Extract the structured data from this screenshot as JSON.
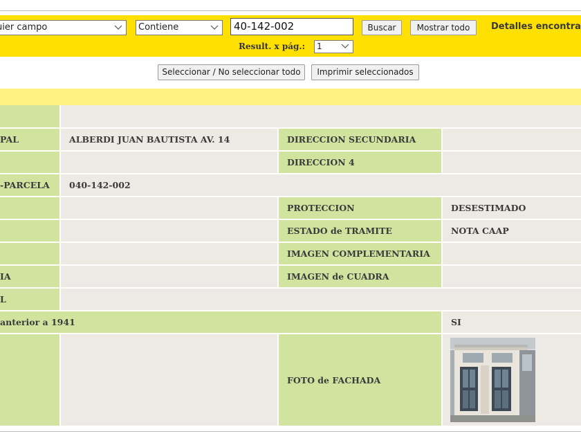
{
  "search": {
    "field_select": "uier campo",
    "condition_select": "Contiene",
    "query_value": "40-142-002",
    "search_button": "Buscar",
    "show_all_button": "Mostrar todo",
    "details_label": "Detalles encontra",
    "per_page_label": "Result. x pág.:",
    "per_page_value": "1"
  },
  "actions": {
    "toggle_select_button": "Seleccionar / No seleccionar todo",
    "print_button": "Imprimir seleccionados"
  },
  "record": {
    "direccion_principal_label": "PAL",
    "direccion_principal_value": "ALBERDI JUAN BAUTISTA AV. 14",
    "direccion_secundaria_label": "DIRECCION SECUNDARIA",
    "direccion_4_label": "DIRECCION 4",
    "parcela_label": "-PARCELA",
    "parcela_value": "040-142-002",
    "proteccion_label": "PROTECCION",
    "proteccion_value": "DESESTIMADO",
    "estado_tramite_label": "ESTADO de TRAMITE",
    "estado_tramite_value": "NOTA CAAP",
    "imagen_complementaria_label": "IMAGEN COMPLEMENTARIA",
    "row8_label": "IA",
    "imagen_cuadra_label": "IMAGEN de CUADRA",
    "row9_label": "L",
    "anterior_1941_label": "anterior a 1941",
    "anterior_1941_value": "SI",
    "foto_fachada_label": "FOTO de FACHADA"
  },
  "colors": {
    "search_bar": "#ffe000",
    "band": "#fff280",
    "label_cell": "#d0e39f",
    "value_cell": "#ede9e5"
  }
}
